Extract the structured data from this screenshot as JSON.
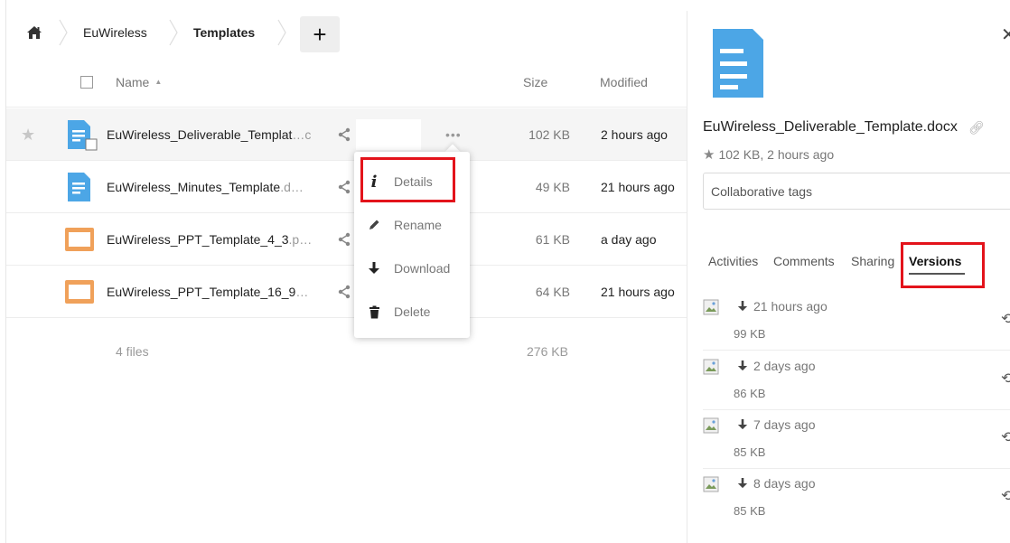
{
  "breadcrumb": {
    "home_icon": "home-icon",
    "items": [
      {
        "label": "EuWireless"
      },
      {
        "label": "Templates"
      }
    ],
    "add_label": "+"
  },
  "table": {
    "columns": {
      "name": "Name",
      "size": "Size",
      "modified": "Modified"
    },
    "rows": [
      {
        "name": "EuWireless_Deliverable_Templat",
        "ext": "…c",
        "size": "102 KB",
        "modified": "2 hours ago",
        "icon": "document-icon",
        "selected": true
      },
      {
        "name": "EuWireless_Minutes_Template",
        "ext": ".d…",
        "size": "49 KB",
        "modified": "21 hours ago",
        "icon": "document-icon"
      },
      {
        "name": "EuWireless_PPT_Template_4_3",
        "ext": ".p…",
        "size": "61 KB",
        "modified": "a day ago",
        "icon": "presentation-icon"
      },
      {
        "name": "EuWireless_PPT_Template_16_9",
        "ext": "…",
        "size": "64 KB",
        "modified": "21 hours ago",
        "icon": "presentation-icon"
      }
    ],
    "summary": {
      "count": "4 files",
      "total": "276 KB"
    }
  },
  "context_menu": {
    "items": [
      {
        "label": "Details",
        "icon": "info-icon"
      },
      {
        "label": "Rename",
        "icon": "pencil-icon"
      },
      {
        "label": "Download",
        "icon": "download-icon"
      },
      {
        "label": "Delete",
        "icon": "trash-icon"
      }
    ]
  },
  "sidebar": {
    "filename": "EuWireless_Deliverable_Template.docx",
    "meta": "102 KB, 2 hours ago",
    "tags_placeholder": "Collaborative tags",
    "tabs": [
      "Activities",
      "Comments",
      "Sharing",
      "Versions"
    ],
    "active_tab": "Versions",
    "versions": [
      {
        "time": "21 hours ago",
        "size": "99 KB"
      },
      {
        "time": "2 days ago",
        "size": "86 KB"
      },
      {
        "time": "7 days ago",
        "size": "85 KB"
      },
      {
        "time": "8 days ago",
        "size": "85 KB"
      }
    ]
  },
  "colors": {
    "doc_blue": "#4ca6e6",
    "ppt_orange": "#f0a15a",
    "highlight_red": "#e3131b"
  }
}
